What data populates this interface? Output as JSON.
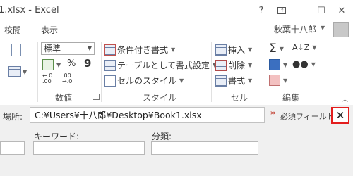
{
  "window": {
    "title": "1.xlsx - Excel",
    "help_icon": "?",
    "minimize_icon": "–",
    "restore_icon": "☐",
    "close_icon": "✕"
  },
  "menu": {
    "items": [
      "校閲",
      "表示"
    ],
    "user_name": "秋葉十八郎"
  },
  "ribbon": {
    "number_format": "標準",
    "number_symbols": {
      "percent": "%",
      "comma": "9"
    },
    "style_buttons": [
      "条件付き書式",
      "テーブルとして書式設定",
      "セルのスタイル"
    ],
    "cell_buttons": [
      "挿入",
      "削除",
      "書式"
    ],
    "groups": [
      "数値",
      "スタイル",
      "セル",
      "編集"
    ],
    "edit_symbols": {
      "sum": "Σ"
    }
  },
  "location": {
    "label": "場所:",
    "value": "C:¥Users¥十八郎¥Desktop¥Book1.xlsx",
    "required_star": "*",
    "required_label": "必須フィールド",
    "close_label": "✕"
  },
  "fields": {
    "keyword_label": "キーワード:",
    "category_label": "分類:"
  }
}
